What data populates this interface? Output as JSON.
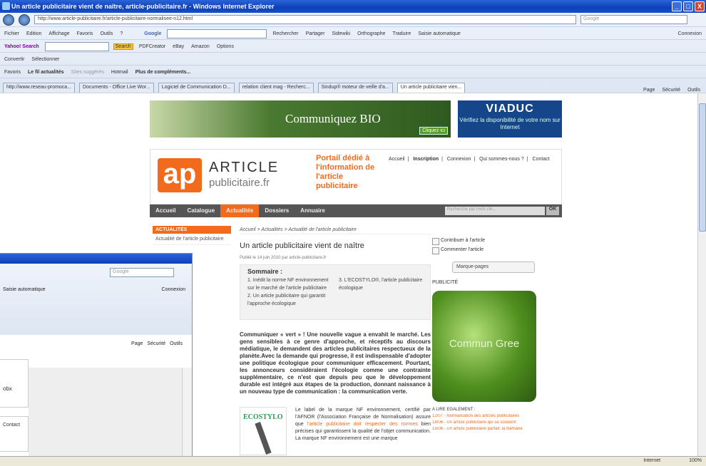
{
  "window": {
    "title": "Un article publicitaire vient de naître, article-publicitaire.fr - Windows Internet Explorer",
    "minimize": "_",
    "maximize": "□",
    "close": "X"
  },
  "toolbar": {
    "address": "http://www.article-publicitaire.fr/article-publicitaire-normalisee-n12.html",
    "search_placeholder": "Google",
    "menus": [
      "Fichier",
      "Edition",
      "Affichage",
      "Favoris",
      "Outils",
      "?"
    ],
    "google_label": "Google",
    "google_items": [
      "Rechercher",
      "Partager",
      "Sidewiki",
      "Orthographe",
      "Traduire",
      "Saisie automatique"
    ],
    "connexion": "Connexion",
    "yahoo_label": "Yahoo! Search",
    "yahoo_items": [
      "Search",
      "PDFCreator",
      "eBay",
      "Amazon",
      "Options"
    ],
    "convert": "Convertir",
    "select": "Sélectionner",
    "favoris": "Favoris",
    "fav_items": [
      "Le fil actualités",
      "Sites suggérés",
      "Hotmail",
      "Plus de compléments..."
    ],
    "tabs": [
      "http://www.reseau-promoca...",
      "Documents - Office Live Wor...",
      "Logiciel de Communication D...",
      "relation client mag - Recherc...",
      "Sindup® moteur de veille d'a...",
      "Un article publicitaire vien..."
    ],
    "tools": [
      "Page",
      "Sécurité",
      "Outils"
    ]
  },
  "banners": {
    "bio": "Communiquez BIO",
    "bio_cta": "Cliquez ici",
    "viaduc": "VIADUC",
    "viaduc_sub": "Vérifiez la disponibilité de votre nom sur Internet"
  },
  "site": {
    "logo": "ap",
    "brand1": "ARTICLE",
    "brand2": "publicitaire.fr",
    "tagline": "Portail dédié à l'information de l'article publicitaire",
    "topnav": [
      "Accueil",
      "Inscription",
      "Connexion",
      "Qui sommes-nous ?",
      "Contact"
    ],
    "mainnav": [
      "Accueil",
      "Catalogue",
      "Actualités",
      "Dossiers",
      "Annuaire"
    ],
    "search_placeholder": "Recherche par mots clé...",
    "ok": "OK"
  },
  "left": {
    "head": "ACTUALITÉS",
    "items": [
      "Actualité de l'article publicitaire"
    ]
  },
  "article": {
    "crumb": "Accueil > Actualités > Actualité de l'article publicitaire",
    "title": "Un article publicitaire vient de naître",
    "published": "Publié le 14 juin 2010 par article-publicitaire.fr",
    "sommaire_title": "Sommaire :",
    "sommaire_col1": "1. Inédit la norme NF environnement sur le marché de l'article publicitaire 2. Un article publicitaire qui garantit l'approche écologique",
    "sommaire_col2": "3. L'ECOSTYLO®, l'article publicitaire écologique",
    "body": "Communiquer « vert » ! Une nouvelle vague a envahit le marché. Les gens sensibles à ce genre d'approche, et réceptifs au discours médiatique, le demandent des articles publicitaires respectueux de la planète.Avec la demande qui progresse, il est indispensable d'adopter une politique écologique pour communiquer efficacement. Pourtant, les annonceurs considéraient l'écologie comme une contrainte supplémentaire, ce n'est que depuis peu que le développement durable est intégré aux étapes de la production, donnant naissance à un nouveau type de communication : la communication verte.",
    "eco_name": "ECOSTYLO",
    "eco_text_a": "Le label de la marque NF environnement, certifié par l'AFNOR (l'Association Française de Normalisation) assure que ",
    "eco_link": "l'article publicitaire doit respecter des normes",
    "eco_text_b": " bien précises qui garantissent la qualité de l'objet communication. La marque NF environnement est une marque"
  },
  "right": {
    "links": [
      "Contribuer à l'article",
      "Commenter l'article"
    ],
    "bookmarks": "Marque-pages",
    "publicite": "PUBLICITÉ",
    "leaf_text": "Commun Gree",
    "alire": "A LIRE EGALEMENT :",
    "related": [
      "12/07 - Normalisation des articles publicitaires",
      "18/06 - Un article publicitaire qui se souvient",
      "15/06 - Un article publicitaire parfait: la Barbarie"
    ]
  },
  "status": {
    "zone": "Internet",
    "zoom": "100%"
  },
  "win2": {
    "search": "Google",
    "saisie": "Saisie automatique",
    "connexion": "Connexion",
    "tools": [
      "Page",
      "Sécurité",
      "Outils"
    ],
    "tile1": "obx",
    "contact": "Contact"
  }
}
